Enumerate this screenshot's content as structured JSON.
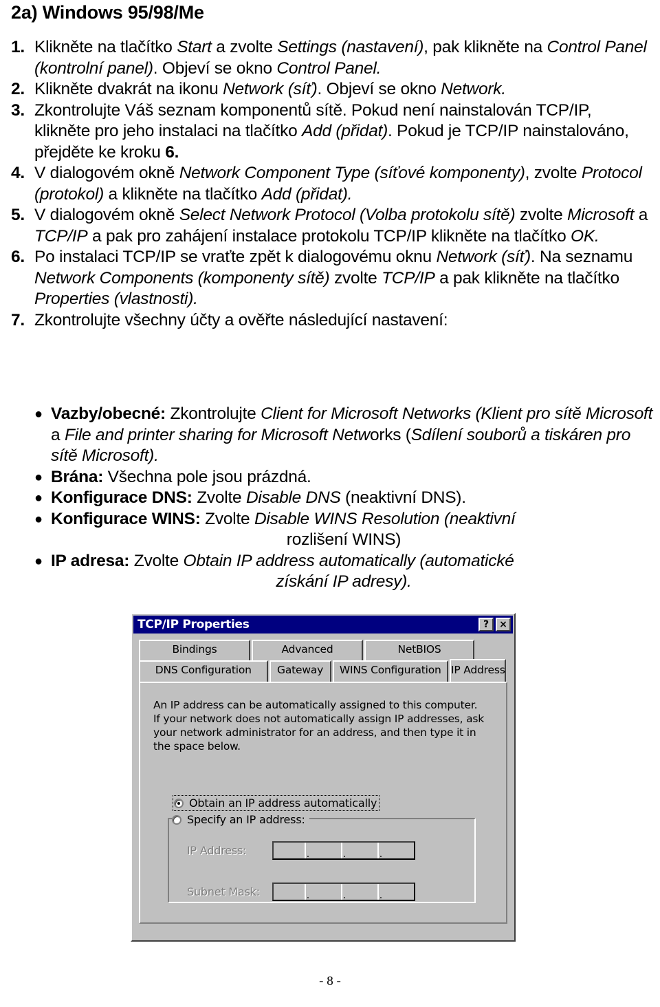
{
  "page": {
    "heading": "2a) Windows 95/98/Me",
    "page_number": "- 8 -"
  },
  "steps": [
    {
      "num": "1.",
      "parts": [
        {
          "t": "Klikněte na tlačítko ",
          "s": "n"
        },
        {
          "t": "Start",
          "s": "i"
        },
        {
          "t": " a zvolte ",
          "s": "n"
        },
        {
          "t": "Settings (nastavení)",
          "s": "i"
        },
        {
          "t": ", pak klikněte na ",
          "s": "n"
        },
        {
          "t": "Control Panel (kontrolní panel)",
          "s": "i"
        },
        {
          "t": ". Objeví se okno ",
          "s": "n"
        },
        {
          "t": "Control Panel.",
          "s": "i"
        }
      ]
    },
    {
      "num": "2.",
      "parts": [
        {
          "t": "Klikněte dvakrát na ikonu ",
          "s": "n"
        },
        {
          "t": "Network (síť)",
          "s": "i"
        },
        {
          "t": ". Objeví se okno ",
          "s": "n"
        },
        {
          "t": "Network.",
          "s": "i"
        }
      ]
    },
    {
      "num": "3.",
      "parts": [
        {
          "t": "Zkontrolujte Váš seznam komponentů sítě. Pokud není nainstalován TCP/IP, klikněte pro jeho instalaci na tlačítko ",
          "s": "n"
        },
        {
          "t": "Add (přidat)",
          "s": "i"
        },
        {
          "t": ". Pokud je TCP/IP nainstalováno, přejděte ke kroku ",
          "s": "n"
        },
        {
          "t": "6.",
          "s": "b"
        }
      ]
    },
    {
      "num": "4.",
      "parts": [
        {
          "t": "V dialogovém okně ",
          "s": "n"
        },
        {
          "t": "Network Component Type (síťové komponenty)",
          "s": "i"
        },
        {
          "t": ", zvolte ",
          "s": "n"
        },
        {
          "t": "Protocol (protokol)",
          "s": "i"
        },
        {
          "t": " a klikněte na tlačítko ",
          "s": "n"
        },
        {
          "t": "Add (přidat).",
          "s": "i"
        }
      ]
    },
    {
      "num": "5.",
      "parts": [
        {
          "t": "V dialogovém okně ",
          "s": "n"
        },
        {
          "t": "Select Network Protocol (Volba protokolu sítě)",
          "s": "i"
        },
        {
          "t": " zvolte ",
          "s": "n"
        },
        {
          "t": "Microsoft",
          "s": "i"
        },
        {
          "t": " a ",
          "s": "n"
        },
        {
          "t": "TCP/IP",
          "s": "i"
        },
        {
          "t": " a pak pro zahájení instalace protokolu TCP/IP klikněte na tlačítko ",
          "s": "n"
        },
        {
          "t": "OK.",
          "s": "i"
        }
      ]
    },
    {
      "num": "6.",
      "parts": [
        {
          "t": "Po instalaci TCP/IP se vraťte zpět k dialogovému oknu ",
          "s": "n"
        },
        {
          "t": "Network (síť)",
          "s": "i"
        },
        {
          "t": ". Na seznamu ",
          "s": "n"
        },
        {
          "t": "Network Components (komponenty sítě)",
          "s": "i"
        },
        {
          "t": " zvolte ",
          "s": "n"
        },
        {
          "t": "TCP/IP",
          "s": "i"
        },
        {
          "t": " a pak klikněte na tlačítko ",
          "s": "n"
        },
        {
          "t": "Properties (vlastnosti).",
          "s": "i"
        }
      ]
    },
    {
      "num": "7.",
      "parts": [
        {
          "t": "Zkontrolujte všechny účty a ověřte následující nastavení:",
          "s": "n"
        }
      ]
    }
  ],
  "bullets": [
    {
      "dot": "●",
      "parts": [
        {
          "t": "Vazby/obecné:",
          "s": "b"
        },
        {
          "t": " Zkontrolujte ",
          "s": "n"
        },
        {
          "t": "Client for Microsoft Networks (Klient pro sítě Microsoft",
          "s": "i"
        },
        {
          "t": " a ",
          "s": "n"
        },
        {
          "t": "File and printer sharing for Microsoft Netw",
          "s": "i"
        },
        {
          "t": "orks (",
          "s": "n"
        },
        {
          "t": "Sdílení souborů a tiskáren pro sítě Microsoft).",
          "s": "i"
        }
      ]
    },
    {
      "dot": "●",
      "parts": [
        {
          "t": "Brána:",
          "s": "b"
        },
        {
          "t": " Všechna pole jsou prázdná.",
          "s": "n"
        }
      ]
    },
    {
      "dot": "●",
      "parts": [
        {
          "t": "Konfigurace DNS:",
          "s": "b"
        },
        {
          "t": " Zvolte ",
          "s": "n"
        },
        {
          "t": "Disable DNS ",
          "s": "i"
        },
        {
          "t": "(neaktivní DNS).",
          "s": "n"
        }
      ]
    },
    {
      "dot": "●",
      "parts": [
        {
          "t": "Konfigurace WINS:",
          "s": "b"
        },
        {
          "t": " Zvolte ",
          "s": "n"
        },
        {
          "t": "Disable WINS Resolution (neaktivní",
          "s": "i"
        }
      ]
    },
    {
      "dot": "",
      "center": true,
      "parts": [
        {
          "t": "rozlišení WINS)",
          "s": "n"
        }
      ]
    },
    {
      "dot": "●",
      "parts": [
        {
          "t": "IP adresa:",
          "s": "b"
        },
        {
          "t": " Zvolte ",
          "s": "n"
        },
        {
          "t": "Obtain IP address automatically (automatické",
          "s": "i"
        }
      ]
    },
    {
      "dot": "",
      "center": true,
      "parts": [
        {
          "t": "získání IP adresy).",
          "s": "i"
        }
      ]
    }
  ],
  "dialog": {
    "title": "TCP/IP Properties",
    "help_button": "?",
    "close_button": "×",
    "tabs_row1": [
      {
        "label": "Bindings",
        "active": false
      },
      {
        "label": "Advanced",
        "active": false
      },
      {
        "label": "NetBIOS",
        "active": false
      }
    ],
    "tabs_row2": [
      {
        "label": "DNS Configuration",
        "active": false
      },
      {
        "label": "Gateway",
        "active": false
      },
      {
        "label": "WINS Configuration",
        "active": false
      },
      {
        "label": "IP Address",
        "active": true
      }
    ],
    "description_lines": [
      "An IP address can be automatically assigned to this computer.",
      "If your network does not automatically assign IP addresses, ask",
      "your network administrator for an address, and then type it in",
      "the space below."
    ],
    "radio_auto": {
      "label": "Obtain an IP address automatically",
      "checked": true
    },
    "radio_specify": {
      "label": "Specify an IP address:",
      "checked": false
    },
    "fields": [
      {
        "label": "IP Address:",
        "value": "",
        "disabled": true
      },
      {
        "label": "Subnet Mask:",
        "value": "",
        "disabled": true
      }
    ],
    "colors": {
      "titlebar": "#000080",
      "face": "#c0c0c0",
      "shadow": "#808080",
      "dark": "#404040",
      "light": "#ffffff",
      "text": "#000000",
      "disabled_text": "#808080"
    }
  }
}
